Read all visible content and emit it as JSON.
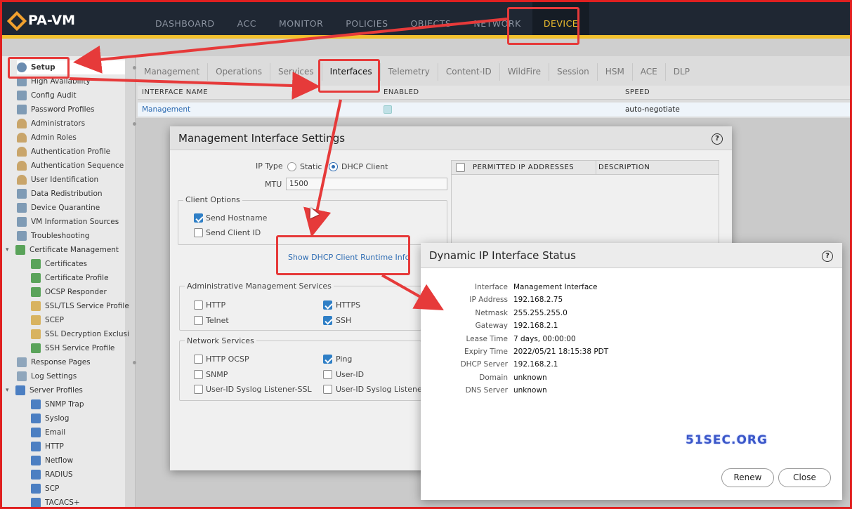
{
  "app": {
    "logo": "PA-VM"
  },
  "nav": {
    "tabs": [
      "DASHBOARD",
      "ACC",
      "MONITOR",
      "POLICIES",
      "OBJECTS",
      "NETWORK",
      "DEVICE"
    ],
    "active": "DEVICE"
  },
  "sidebar": {
    "items": [
      {
        "label": "Setup",
        "icon": "gear-icon"
      },
      {
        "label": "High Availability",
        "icon": "ha-icon"
      },
      {
        "label": "Config Audit",
        "icon": "audit-icon"
      },
      {
        "label": "Password Profiles",
        "icon": "key-icon"
      },
      {
        "label": "Administrators",
        "icon": "user-icon"
      },
      {
        "label": "Admin Roles",
        "icon": "user-icon"
      },
      {
        "label": "Authentication Profile",
        "icon": "user-icon"
      },
      {
        "label": "Authentication Sequence",
        "icon": "user-icon"
      },
      {
        "label": "User Identification",
        "icon": "user-icon"
      },
      {
        "label": "Data Redistribution",
        "icon": "redistribution-icon"
      },
      {
        "label": "Device Quarantine",
        "icon": "quarantine-icon"
      },
      {
        "label": "VM Information Sources",
        "icon": "vm-icon"
      },
      {
        "label": "Troubleshooting",
        "icon": "wrench-icon"
      },
      {
        "label": "Certificate Management",
        "icon": "certificate-icon"
      },
      {
        "label": "Certificates",
        "icon": "certificate-icon"
      },
      {
        "label": "Certificate Profile",
        "icon": "certificate-icon"
      },
      {
        "label": "OCSP Responder",
        "icon": "certificate-icon"
      },
      {
        "label": "SSL/TLS Service Profile",
        "icon": "lock-icon"
      },
      {
        "label": "SCEP",
        "icon": "lock-icon"
      },
      {
        "label": "SSL Decryption Exclusi",
        "icon": "lock-icon"
      },
      {
        "label": "SSH Service Profile",
        "icon": "certificate-icon"
      },
      {
        "label": "Response Pages",
        "icon": "page-icon"
      },
      {
        "label": "Log Settings",
        "icon": "log-icon"
      },
      {
        "label": "Server Profiles",
        "icon": "server-icon"
      },
      {
        "label": "SNMP Trap",
        "icon": "server-icon"
      },
      {
        "label": "Syslog",
        "icon": "server-icon"
      },
      {
        "label": "Email",
        "icon": "server-icon"
      },
      {
        "label": "HTTP",
        "icon": "server-icon"
      },
      {
        "label": "Netflow",
        "icon": "server-icon"
      },
      {
        "label": "RADIUS",
        "icon": "server-icon"
      },
      {
        "label": "SCP",
        "icon": "server-icon"
      },
      {
        "label": "TACACS+",
        "icon": "server-icon"
      }
    ]
  },
  "subtabs": {
    "items": [
      "Management",
      "Operations",
      "Services",
      "Interfaces",
      "Telemetry",
      "Content-ID",
      "WildFire",
      "Session",
      "HSM",
      "ACE",
      "DLP"
    ],
    "active": "Interfaces"
  },
  "grid": {
    "columns": [
      "INTERFACE NAME",
      "ENABLED",
      "SPEED"
    ],
    "row": {
      "name": "Management",
      "speed": "auto-negotiate"
    }
  },
  "mgmt_dialog": {
    "title": "Management Interface Settings",
    "ip_type_label": "IP Type",
    "ip_type_static": "Static",
    "ip_type_dhcp": "DHCP Client",
    "mtu_label": "MTU",
    "mtu_value": "1500",
    "client_options_legend": "Client Options",
    "send_hostname": "Send Hostname",
    "send_client_id": "Send Client ID",
    "show_dhcp_link": "Show DHCP Client Runtime Info",
    "admin_services_legend": "Administrative Management Services",
    "http": "HTTP",
    "https": "HTTPS",
    "telnet": "Telnet",
    "ssh": "SSH",
    "network_services_legend": "Network Services",
    "http_ocsp": "HTTP OCSP",
    "ping": "Ping",
    "snmp": "SNMP",
    "user_id": "User-ID",
    "userid_syslog_ssl": "User-ID Syslog Listener-SSL",
    "userid_syslog": "User-ID Syslog Listener-",
    "permitted_col": "PERMITTED IP ADDRESSES",
    "description_col": "DESCRIPTION"
  },
  "status_dialog": {
    "title": "Dynamic IP Interface Status",
    "fields": [
      {
        "key": "Interface",
        "value": "Management Interface"
      },
      {
        "key": "IP Address",
        "value": "192.168.2.75"
      },
      {
        "key": "Netmask",
        "value": "255.255.255.0"
      },
      {
        "key": "Gateway",
        "value": "192.168.2.1"
      },
      {
        "key": "Lease Time",
        "value": "7 days, 00:00:00"
      },
      {
        "key": "Expiry Time",
        "value": "2022/05/21 18:15:38 PDT"
      },
      {
        "key": "DHCP Server",
        "value": "192.168.2.1"
      },
      {
        "key": "Domain",
        "value": "unknown"
      },
      {
        "key": "DNS Server",
        "value": "unknown"
      }
    ],
    "renew": "Renew",
    "close": "Close"
  },
  "watermark": "51SEC.ORG",
  "colors": {
    "accent": "#f2c12e",
    "annotation": "#e63a3a",
    "link": "#2f6db3",
    "nav_bg": "#1f2733"
  }
}
